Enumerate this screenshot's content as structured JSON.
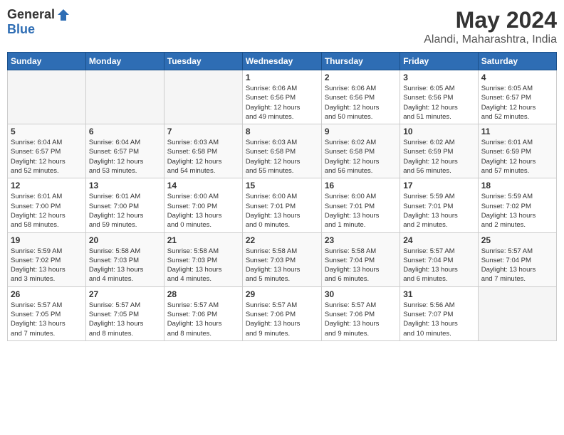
{
  "logo": {
    "general": "General",
    "blue": "Blue"
  },
  "title": "May 2024",
  "location": "Alandi, Maharashtra, India",
  "days_of_week": [
    "Sunday",
    "Monday",
    "Tuesday",
    "Wednesday",
    "Thursday",
    "Friday",
    "Saturday"
  ],
  "weeks": [
    [
      {
        "day": "",
        "info": ""
      },
      {
        "day": "",
        "info": ""
      },
      {
        "day": "",
        "info": ""
      },
      {
        "day": "1",
        "info": "Sunrise: 6:06 AM\nSunset: 6:56 PM\nDaylight: 12 hours\nand 49 minutes."
      },
      {
        "day": "2",
        "info": "Sunrise: 6:06 AM\nSunset: 6:56 PM\nDaylight: 12 hours\nand 50 minutes."
      },
      {
        "day": "3",
        "info": "Sunrise: 6:05 AM\nSunset: 6:56 PM\nDaylight: 12 hours\nand 51 minutes."
      },
      {
        "day": "4",
        "info": "Sunrise: 6:05 AM\nSunset: 6:57 PM\nDaylight: 12 hours\nand 52 minutes."
      }
    ],
    [
      {
        "day": "5",
        "info": "Sunrise: 6:04 AM\nSunset: 6:57 PM\nDaylight: 12 hours\nand 52 minutes."
      },
      {
        "day": "6",
        "info": "Sunrise: 6:04 AM\nSunset: 6:57 PM\nDaylight: 12 hours\nand 53 minutes."
      },
      {
        "day": "7",
        "info": "Sunrise: 6:03 AM\nSunset: 6:58 PM\nDaylight: 12 hours\nand 54 minutes."
      },
      {
        "day": "8",
        "info": "Sunrise: 6:03 AM\nSunset: 6:58 PM\nDaylight: 12 hours\nand 55 minutes."
      },
      {
        "day": "9",
        "info": "Sunrise: 6:02 AM\nSunset: 6:58 PM\nDaylight: 12 hours\nand 56 minutes."
      },
      {
        "day": "10",
        "info": "Sunrise: 6:02 AM\nSunset: 6:59 PM\nDaylight: 12 hours\nand 56 minutes."
      },
      {
        "day": "11",
        "info": "Sunrise: 6:01 AM\nSunset: 6:59 PM\nDaylight: 12 hours\nand 57 minutes."
      }
    ],
    [
      {
        "day": "12",
        "info": "Sunrise: 6:01 AM\nSunset: 7:00 PM\nDaylight: 12 hours\nand 58 minutes."
      },
      {
        "day": "13",
        "info": "Sunrise: 6:01 AM\nSunset: 7:00 PM\nDaylight: 12 hours\nand 59 minutes."
      },
      {
        "day": "14",
        "info": "Sunrise: 6:00 AM\nSunset: 7:00 PM\nDaylight: 13 hours\nand 0 minutes."
      },
      {
        "day": "15",
        "info": "Sunrise: 6:00 AM\nSunset: 7:01 PM\nDaylight: 13 hours\nand 0 minutes."
      },
      {
        "day": "16",
        "info": "Sunrise: 6:00 AM\nSunset: 7:01 PM\nDaylight: 13 hours\nand 1 minute."
      },
      {
        "day": "17",
        "info": "Sunrise: 5:59 AM\nSunset: 7:01 PM\nDaylight: 13 hours\nand 2 minutes."
      },
      {
        "day": "18",
        "info": "Sunrise: 5:59 AM\nSunset: 7:02 PM\nDaylight: 13 hours\nand 2 minutes."
      }
    ],
    [
      {
        "day": "19",
        "info": "Sunrise: 5:59 AM\nSunset: 7:02 PM\nDaylight: 13 hours\nand 3 minutes."
      },
      {
        "day": "20",
        "info": "Sunrise: 5:58 AM\nSunset: 7:03 PM\nDaylight: 13 hours\nand 4 minutes."
      },
      {
        "day": "21",
        "info": "Sunrise: 5:58 AM\nSunset: 7:03 PM\nDaylight: 13 hours\nand 4 minutes."
      },
      {
        "day": "22",
        "info": "Sunrise: 5:58 AM\nSunset: 7:03 PM\nDaylight: 13 hours\nand 5 minutes."
      },
      {
        "day": "23",
        "info": "Sunrise: 5:58 AM\nSunset: 7:04 PM\nDaylight: 13 hours\nand 6 minutes."
      },
      {
        "day": "24",
        "info": "Sunrise: 5:57 AM\nSunset: 7:04 PM\nDaylight: 13 hours\nand 6 minutes."
      },
      {
        "day": "25",
        "info": "Sunrise: 5:57 AM\nSunset: 7:04 PM\nDaylight: 13 hours\nand 7 minutes."
      }
    ],
    [
      {
        "day": "26",
        "info": "Sunrise: 5:57 AM\nSunset: 7:05 PM\nDaylight: 13 hours\nand 7 minutes."
      },
      {
        "day": "27",
        "info": "Sunrise: 5:57 AM\nSunset: 7:05 PM\nDaylight: 13 hours\nand 8 minutes."
      },
      {
        "day": "28",
        "info": "Sunrise: 5:57 AM\nSunset: 7:06 PM\nDaylight: 13 hours\nand 8 minutes."
      },
      {
        "day": "29",
        "info": "Sunrise: 5:57 AM\nSunset: 7:06 PM\nDaylight: 13 hours\nand 9 minutes."
      },
      {
        "day": "30",
        "info": "Sunrise: 5:57 AM\nSunset: 7:06 PM\nDaylight: 13 hours\nand 9 minutes."
      },
      {
        "day": "31",
        "info": "Sunrise: 5:56 AM\nSunset: 7:07 PM\nDaylight: 13 hours\nand 10 minutes."
      },
      {
        "day": "",
        "info": ""
      }
    ]
  ]
}
